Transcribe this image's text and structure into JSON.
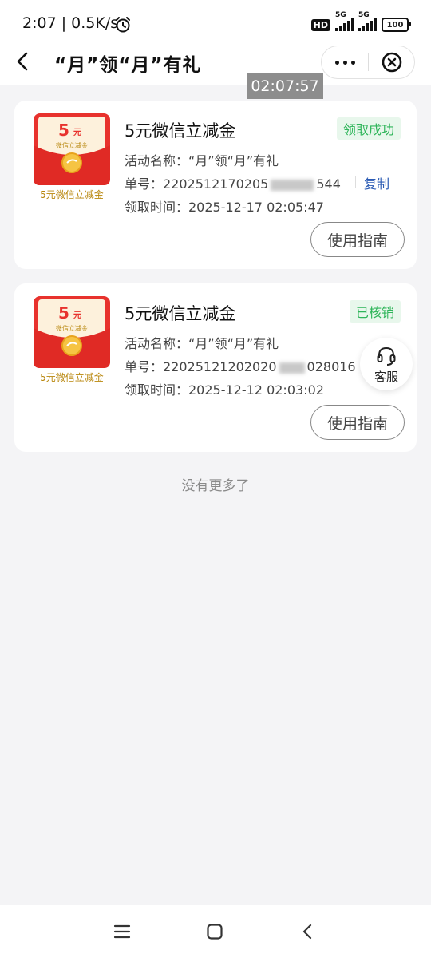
{
  "status_bar": {
    "time": "2:07 | 0.5K/s",
    "hd_badge": "HD",
    "signal_label_1": "5G",
    "signal_label_2": "5G",
    "battery": "100"
  },
  "header": {
    "title": "“月”领“月”有礼",
    "more_icon": "more-icon",
    "close_icon": "close-circle-icon"
  },
  "overlay_time": "02:07:57",
  "coupons": [
    {
      "envelope_amount": "5",
      "envelope_unit": "元",
      "envelope_subtitle": "微信立减金",
      "caption": "5元微信立减金",
      "title": "5元微信立减金",
      "status": "领取成功",
      "status_color": "#2fb55a",
      "activity": "活动名称：“月”领“月”有礼",
      "order_prefix": "单号：2202512170205",
      "order_suffix": "544",
      "copy_label": "复制",
      "receive_time": "领取时间：2025-12-17 02:05:47",
      "guide_label": "使用指南"
    },
    {
      "envelope_amount": "5",
      "envelope_unit": "元",
      "envelope_subtitle": "微信立减金",
      "caption": "5元微信立减金",
      "title": "5元微信立减金",
      "status": "已核销",
      "status_color": "#2fb55a",
      "activity": "活动名称：“月”领“月”有礼",
      "order_prefix": "单号：22025121202020",
      "order_suffix": "028016",
      "receive_time": "领取时间：2025-12-12 02:03:02",
      "guide_label": "使用指南"
    }
  ],
  "customer_service": {
    "label": "客服",
    "icon": "headset-icon"
  },
  "no_more_text": "没有更多了",
  "system_nav": {
    "menu_icon": "menu-icon",
    "home_icon": "home-icon",
    "back_icon": "back-icon"
  }
}
